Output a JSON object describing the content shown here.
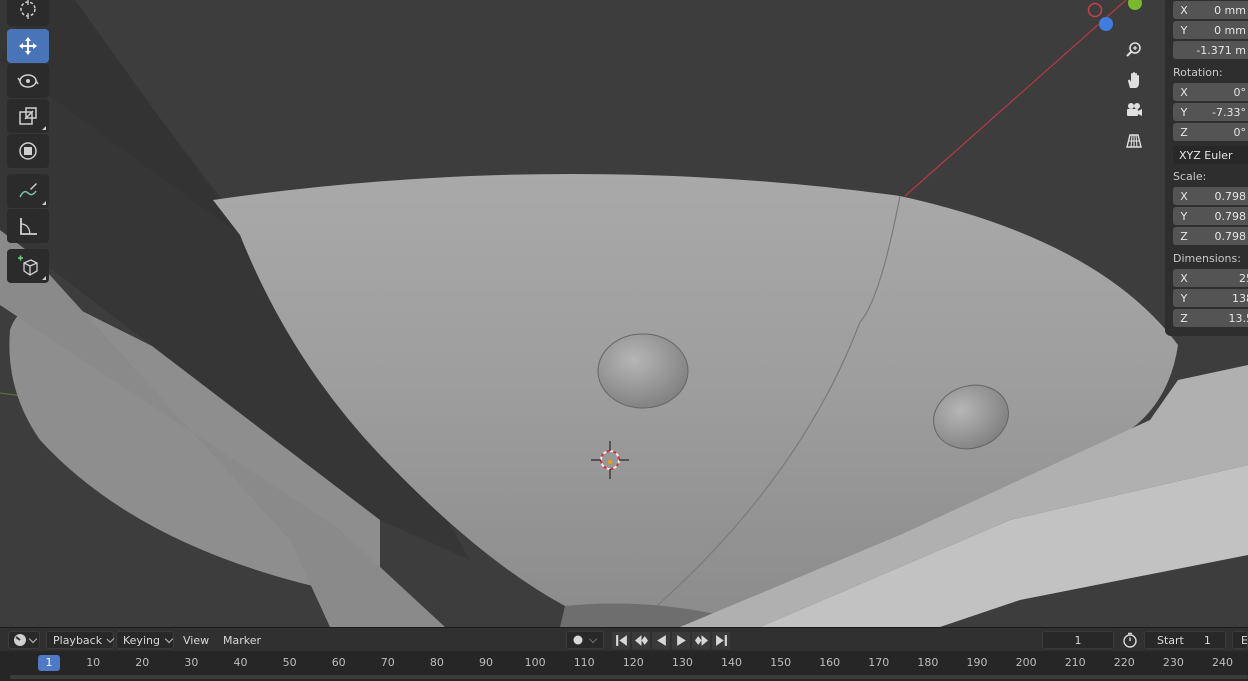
{
  "window": {
    "title": ""
  },
  "toolbar": {
    "tools": [
      {
        "name": "cursor-tool",
        "icon": "cursor-icon",
        "active": false
      },
      {
        "name": "move-tool",
        "icon": "move-icon",
        "active": true
      },
      {
        "name": "rotate-tool",
        "icon": "rotate-icon",
        "active": false
      },
      {
        "name": "scale-tool",
        "icon": "scale-icon",
        "active": false
      },
      {
        "name": "transform-tool",
        "icon": "transform-icon",
        "active": false
      },
      {
        "name": "annotate-tool",
        "icon": "annotate-icon",
        "active": false
      },
      {
        "name": "measure-tool",
        "icon": "measure-icon",
        "active": false
      },
      {
        "name": "add-cube-tool",
        "icon": "add-cube-icon",
        "active": false
      }
    ]
  },
  "navigation": {
    "zoom_icon": "zoom-icon",
    "pan_icon": "hand-icon",
    "camera_icon": "camera-icon",
    "perspective_icon": "grid-icon"
  },
  "transform_panel": {
    "location": {
      "x": "0 mm",
      "y": "0 mm",
      "z": "-1.371 m"
    },
    "rotation_label": "Rotation:",
    "rotation": {
      "x": "0°",
      "y": "-7.33°",
      "z": "0°"
    },
    "rotation_mode": "XYZ Euler",
    "scale_label": "Scale:",
    "scale": {
      "x": "0.798",
      "y": "0.798",
      "z": "0.798"
    },
    "dimensions_label": "Dimensions:",
    "dimensions": {
      "x": "25",
      "y": "138",
      "z": "13.5"
    },
    "axis": {
      "x": "X",
      "y": "Y",
      "z": "Z"
    }
  },
  "timeline_header": {
    "playback": "Playback",
    "keying": "Keying",
    "view": "View",
    "marker": "Marker",
    "current_frame": "1",
    "start_label": "Start",
    "start_value": "1",
    "end_label": "E"
  },
  "timeline": {
    "current_frame": "1",
    "ticks": [
      "10",
      "20",
      "30",
      "40",
      "50",
      "60",
      "70",
      "80",
      "90",
      "100",
      "110",
      "120",
      "130",
      "140",
      "150",
      "160",
      "170",
      "180",
      "190",
      "200",
      "210",
      "220",
      "230",
      "240"
    ]
  },
  "colors": {
    "accent": "#4a74b8",
    "axis_x": "#c8414a",
    "axis_y": "#7ab82d",
    "axis_z": "#3f7ede",
    "viewport_bg": "#3d3d3d"
  }
}
